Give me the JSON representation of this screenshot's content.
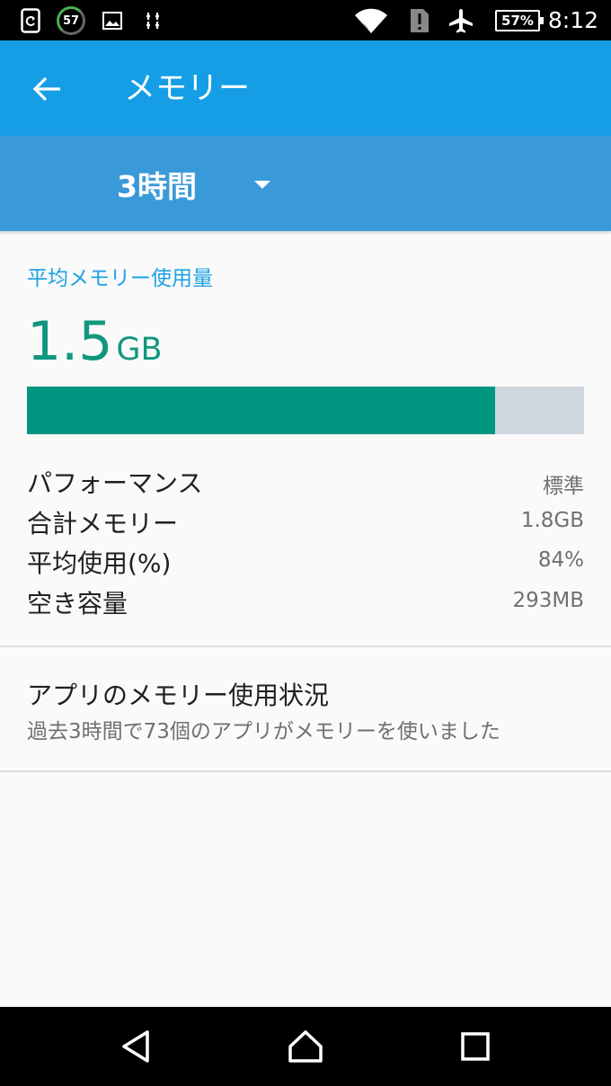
{
  "status_bar": {
    "notif_badge": "57",
    "battery_percent": "57%",
    "time": "8:12",
    "icons": [
      "sync-icon",
      "progress-ring-icon",
      "image-icon",
      "usb-debug-icon",
      "wifi-icon",
      "sim-alert-icon",
      "airplane-icon",
      "battery-icon"
    ]
  },
  "app_bar": {
    "title": "メモリー"
  },
  "range": {
    "selected": "3時間"
  },
  "summary": {
    "section_title": "平均メモリー使用量",
    "avg_value": "1.5",
    "avg_unit": "GB",
    "usage_fraction": 0.84,
    "colors": {
      "used": "#00967f",
      "free": "#cfd6dd",
      "accent": "#1ea2e3"
    }
  },
  "stats": [
    {
      "label": "パフォーマンス",
      "value": "標準"
    },
    {
      "label": "合計メモリー",
      "value": "1.8GB"
    },
    {
      "label": "平均使用(%)",
      "value": "84%"
    },
    {
      "label": "空き容量",
      "value": "293MB"
    }
  ],
  "app_usage": {
    "title": "アプリのメモリー使用状況",
    "subtitle": "過去3時間で73個のアプリがメモリーを使いました"
  }
}
